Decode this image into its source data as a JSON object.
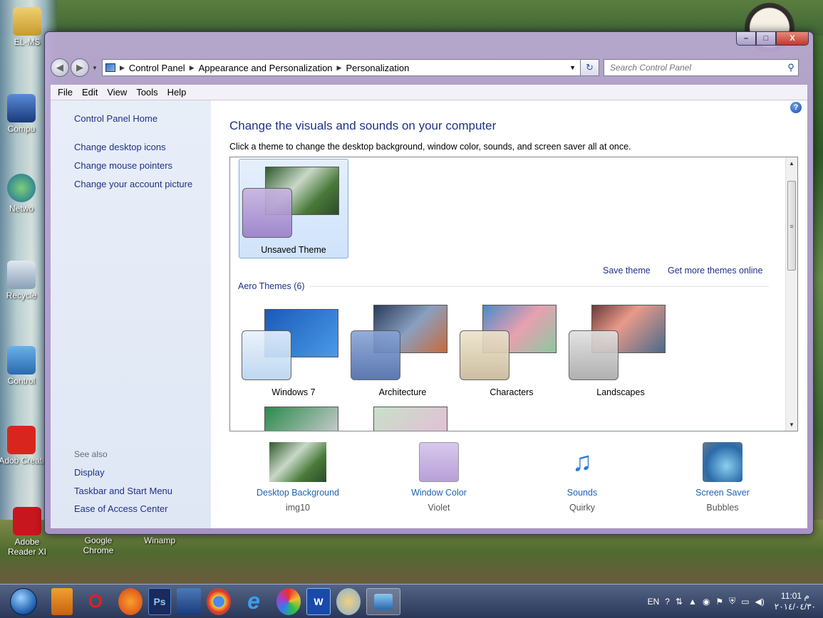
{
  "desktop": {
    "icons": [
      {
        "label": "EL-MS"
      },
      {
        "label": "Compu"
      },
      {
        "label": "Netwo"
      },
      {
        "label": "Recycle"
      },
      {
        "label": "Control"
      },
      {
        "label": "Adob Creati"
      },
      {
        "label": "Adobe Reader XI"
      },
      {
        "label": "Google Chrome"
      },
      {
        "label": "Winamp"
      }
    ]
  },
  "window": {
    "caption_buttons": {
      "minimize": "–",
      "maximize": "□",
      "close": "X"
    },
    "address": {
      "crumbs": [
        "Control Panel",
        "Appearance and Personalization",
        "Personalization"
      ]
    },
    "search": {
      "placeholder": "Search Control Panel"
    },
    "menu": [
      "File",
      "Edit",
      "View",
      "Tools",
      "Help"
    ],
    "left_pane": {
      "home": "Control Panel Home",
      "links": [
        "Change desktop icons",
        "Change mouse pointers",
        "Change your account picture"
      ],
      "see_also_label": "See also",
      "see_also": [
        "Display",
        "Taskbar and Start Menu",
        "Ease of Access Center"
      ]
    },
    "main": {
      "title": "Change the visuals and sounds on your computer",
      "subtitle": "Click a theme to change the desktop background, window color, sounds, and screen saver all at once.",
      "my_themes": [
        {
          "name": "Unsaved Theme",
          "selected": true
        }
      ],
      "save_theme": "Save theme",
      "get_more": "Get more themes online",
      "aero_group": "Aero Themes (6)",
      "aero_themes": [
        {
          "name": "Windows 7",
          "back": "#1f6fd0",
          "front": "#cfe2f7"
        },
        {
          "name": "Architecture",
          "back": "#4a5a6e",
          "front": "#6b86b5"
        },
        {
          "name": "Characters",
          "back": "#7fa8c8",
          "front": "#cfc4a6"
        },
        {
          "name": "Landscapes",
          "back": "#9a6e5a",
          "front": "#c6c6c6"
        }
      ],
      "bottom": [
        {
          "title": "Desktop Background",
          "value": "img10"
        },
        {
          "title": "Window Color",
          "value": "Violet"
        },
        {
          "title": "Sounds",
          "value": "Quirky"
        },
        {
          "title": "Screen Saver",
          "value": "Bubbles"
        }
      ]
    },
    "help_icon": "?"
  },
  "taskbar": {
    "pinned": [
      "",
      "",
      "",
      "Ps",
      "",
      "",
      "",
      "",
      "W",
      "",
      ""
    ],
    "tray": {
      "lang": "EN",
      "time": "11:01 م",
      "date": "٢٠١٤/٠٤/٣٠"
    }
  }
}
